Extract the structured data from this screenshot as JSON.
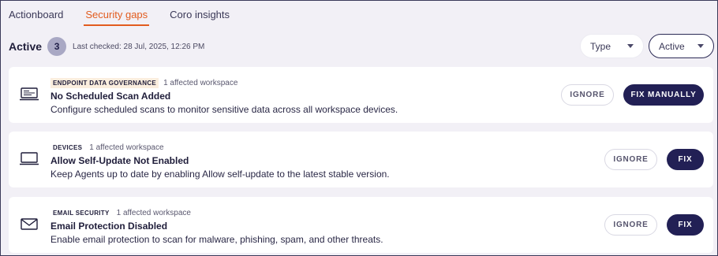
{
  "tabs": [
    {
      "label": "Actionboard",
      "active": false
    },
    {
      "label": "Security gaps",
      "active": true
    },
    {
      "label": "Coro insights",
      "active": false
    }
  ],
  "status": {
    "label": "Active",
    "count": "3",
    "last_checked": "Last checked: 28 Jul, 2025, 12:26 PM"
  },
  "filters": {
    "type_label": "Type",
    "status_label": "Active"
  },
  "cards": [
    {
      "icon": "laptop-data-icon",
      "category": "ENDPOINT DATA GOVERNANCE",
      "affected": "1 affected workspace",
      "title": "No Scheduled Scan Added",
      "description": "Configure scheduled scans to monitor sensitive data across all workspace devices.",
      "ignore_label": "IGNORE",
      "fix_label": "FIX MANUALLY"
    },
    {
      "icon": "laptop-icon",
      "category": "DEVICES",
      "affected": "1 affected workspace",
      "title": "Allow Self-Update Not Enabled",
      "description": "Keep Agents up to date by enabling Allow self-update to the latest stable version.",
      "ignore_label": "IGNORE",
      "fix_label": "FIX"
    },
    {
      "icon": "envelope-icon",
      "category": "EMAIL SECURITY",
      "affected": "1 affected workspace",
      "title": "Email Protection Disabled",
      "description": "Enable email protection to scan for malware, phishing, spam, and other threats.",
      "ignore_label": "IGNORE",
      "fix_label": "FIX"
    }
  ],
  "colors": {
    "accent": "#e25c1f",
    "primary_button": "#222055",
    "background": "#f2f0f6"
  }
}
